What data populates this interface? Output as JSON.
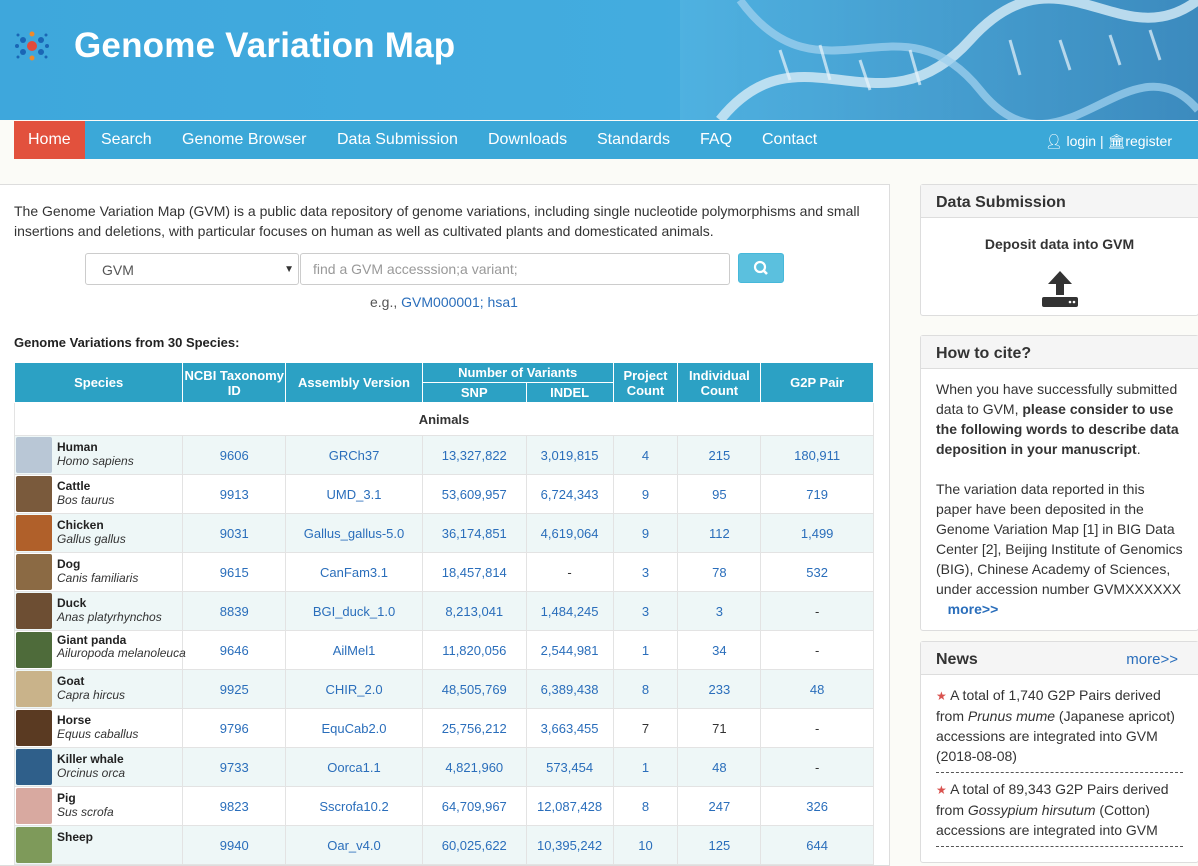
{
  "header": {
    "title": "Genome Variation Map"
  },
  "nav": {
    "items": [
      "Home",
      "Search",
      "Genome Browser",
      "Data Submission",
      "Downloads",
      "Standards",
      "FAQ",
      "Contact"
    ],
    "login": "login",
    "register": "register"
  },
  "intro": "The Genome Variation Map (GVM) is a public data repository of genome variations, including single nucleotide polymorphisms and small insertions and deletions, with particular focuses on human as well as cultivated plants and domesticated animals.",
  "search": {
    "select_value": "GVM",
    "placeholder": "find a GVM accesssion;a variant;",
    "eg_prefix": "e.g.,",
    "eg_link1": "GVM000001;",
    "eg_link2": "hsa1"
  },
  "section_title": "Genome Variations from 30 Species:",
  "table": {
    "headers": {
      "species": "Species",
      "taxonomy": "NCBI Taxonomy ID",
      "assembly": "Assembly Version",
      "variants": "Number of Variants",
      "snp": "SNP",
      "indel": "INDEL",
      "project": "Project Count",
      "individual": "Individual Count",
      "g2p": "G2P Pair"
    },
    "group": "Animals",
    "rows": [
      {
        "name": "Human",
        "sci": "Homo sapiens",
        "taxid": "9606",
        "assembly": "GRCh37",
        "snp": "13,327,822",
        "indel": "3,019,815",
        "project": "4",
        "individual": "215",
        "g2p": "180,911",
        "color": "#b9c7d6"
      },
      {
        "name": "Cattle",
        "sci": "Bos taurus",
        "taxid": "9913",
        "assembly": "UMD_3.1",
        "snp": "53,609,957",
        "indel": "6,724,343",
        "project": "9",
        "individual": "95",
        "g2p": "719",
        "color": "#7a5a3c"
      },
      {
        "name": "Chicken",
        "sci": "Gallus gallus",
        "taxid": "9031",
        "assembly": "Gallus_gallus-5.0",
        "snp": "36,174,851",
        "indel": "4,619,064",
        "project": "9",
        "individual": "112",
        "g2p": "1,499",
        "color": "#b0602a"
      },
      {
        "name": "Dog",
        "sci": "Canis familiaris",
        "taxid": "9615",
        "assembly": "CanFam3.1",
        "snp": "18,457,814",
        "indel": "-",
        "project": "3",
        "individual": "78",
        "g2p": "532",
        "color": "#8b6a44"
      },
      {
        "name": "Duck",
        "sci": "Anas platyrhynchos",
        "taxid": "8839",
        "assembly": "BGI_duck_1.0",
        "snp": "8,213,041",
        "indel": "1,484,245",
        "project": "3",
        "individual": "3",
        "g2p": "-",
        "color": "#6d4e33"
      },
      {
        "name": "Giant panda",
        "sci": "Ailuropoda melanoleuca",
        "taxid": "9646",
        "assembly": "AilMel1",
        "snp": "11,820,056",
        "indel": "2,544,981",
        "project": "1",
        "individual": "34",
        "g2p": "-",
        "color": "#4e6b3a"
      },
      {
        "name": "Goat",
        "sci": "Capra hircus",
        "taxid": "9925",
        "assembly": "CHIR_2.0",
        "snp": "48,505,769",
        "indel": "6,389,438",
        "project": "8",
        "individual": "233",
        "g2p": "48",
        "color": "#c9b38a"
      },
      {
        "name": "Horse",
        "sci": "Equus caballus",
        "taxid": "9796",
        "assembly": "EquCab2.0",
        "snp": "25,756,212",
        "indel": "3,663,455",
        "project": "7",
        "individual": "71",
        "g2p": "-",
        "color": "#5a3a22"
      },
      {
        "name": "Killer whale",
        "sci": "Orcinus orca",
        "taxid": "9733",
        "assembly": "Oorca1.1",
        "snp": "4,821,960",
        "indel": "573,454",
        "project": "1",
        "individual": "48",
        "g2p": "-",
        "color": "#2f5f8a"
      },
      {
        "name": "Pig",
        "sci": "Sus scrofa",
        "taxid": "9823",
        "assembly": "Sscrofa10.2",
        "snp": "64,709,967",
        "indel": "12,087,428",
        "project": "8",
        "individual": "247",
        "g2p": "326",
        "color": "#d8a9a0"
      },
      {
        "name": "Sheep",
        "sci": "",
        "taxid": "9940",
        "assembly": "Oar_v4.0",
        "snp": "60,025,622",
        "indel": "10,395,242",
        "project": "10",
        "individual": "125",
        "g2p": "644",
        "color": "#7e9a5a"
      }
    ]
  },
  "sidebar": {
    "submission": {
      "title": "Data Submission",
      "deposit": "Deposit data into GVM"
    },
    "cite": {
      "title": "How to cite?",
      "p1_a": "When you have successfully submitted data to GVM,",
      "p1_b": "please consider to use the following words to describe data deposition in your manuscript",
      "p1_c": ".",
      "p2": "The variation data reported in this paper have been deposited in the Genome Variation Map [1] in BIG Data Center [2], Beijing Institute of Genomics (BIG), Chinese Academy of Sciences, under accession number GVMXXXXXX",
      "more": "more>>"
    },
    "news": {
      "title": "News",
      "more": "more>>",
      "items": [
        {
          "pre": "A total of 1,740 G2P Pairs derived from",
          "species": "Prunus mume",
          "post": "(Japanese apricot) accessions are integrated into GVM (2018-08-08)"
        },
        {
          "pre": "A total of 89,343 G2P Pairs derived from",
          "species": "Gossypium hirsutum",
          "post": "(Cotton) accessions are integrated into GVM"
        }
      ]
    }
  }
}
